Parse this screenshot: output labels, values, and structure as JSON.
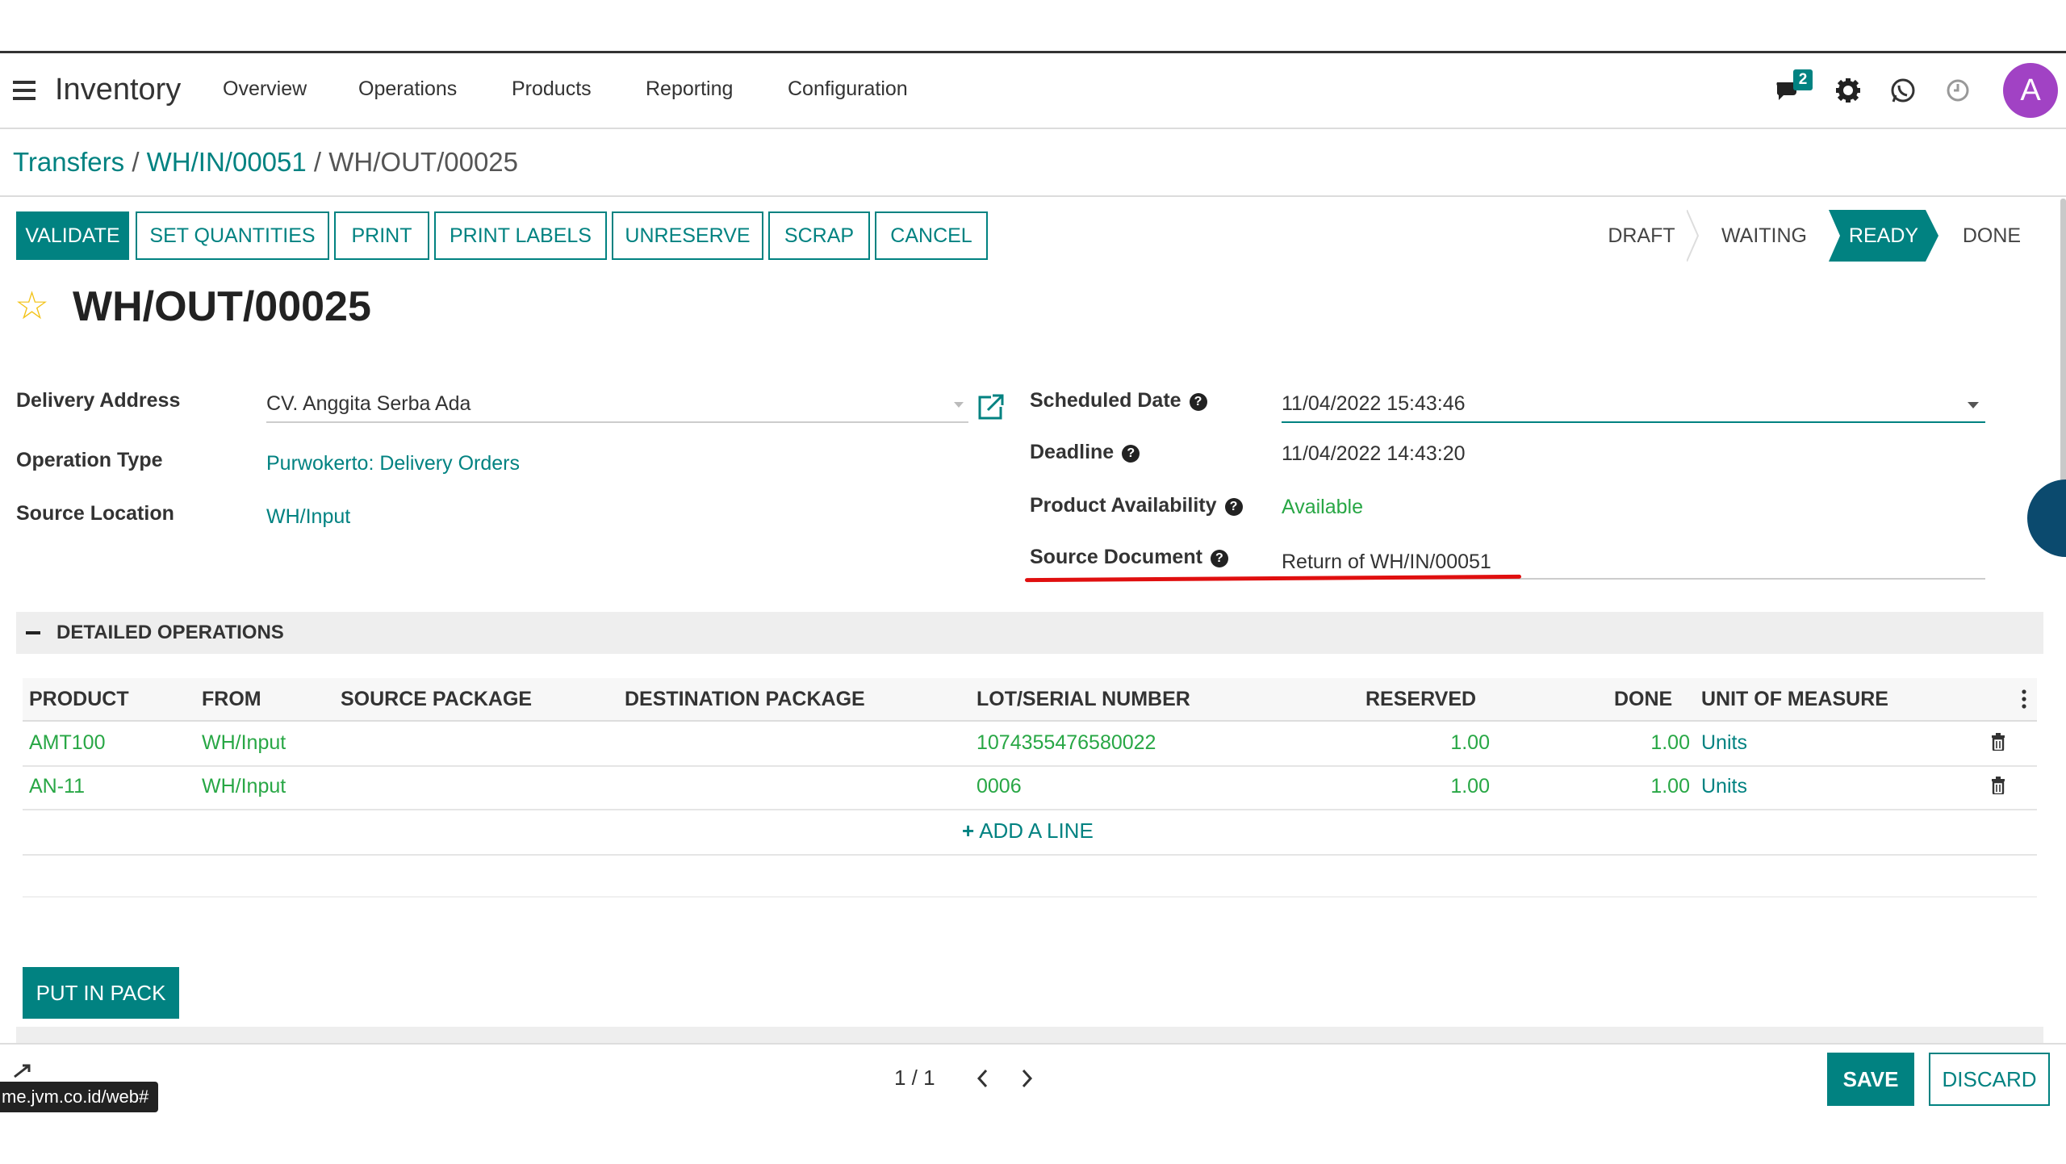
{
  "navbar": {
    "app_title": "Inventory",
    "menu": [
      "Overview",
      "Operations",
      "Products",
      "Reporting",
      "Configuration"
    ],
    "message_count": "2",
    "avatar_letter": "A",
    "icons": [
      "menu-icon",
      "chat-icon",
      "gear-icon",
      "whatsapp-icon",
      "clock-icon"
    ]
  },
  "breadcrumb": {
    "items": [
      "Transfers",
      "WH/IN/00051"
    ],
    "separator": "/",
    "current": "WH/OUT/00025"
  },
  "control_buttons": [
    "VALIDATE",
    "SET QUANTITIES",
    "PRINT",
    "PRINT LABELS",
    "UNRESERVE",
    "SCRAP",
    "CANCEL"
  ],
  "status_bar": {
    "states": [
      "DRAFT",
      "WAITING",
      "READY",
      "DONE"
    ],
    "active": "READY"
  },
  "record": {
    "title": "WH/OUT/00025"
  },
  "form": {
    "delivery_address": {
      "label": "Delivery Address",
      "value": "CV. Anggita Serba Ada"
    },
    "operation_type": {
      "label": "Operation Type",
      "value": "Purwokerto: Delivery Orders"
    },
    "source_location": {
      "label": "Source Location",
      "value": "WH/Input"
    },
    "scheduled_date": {
      "label": "Scheduled Date",
      "value": "11/04/2022 15:43:46"
    },
    "deadline": {
      "label": "Deadline",
      "value": "11/04/2022 14:43:20"
    },
    "product_availability": {
      "label": "Product Availability",
      "value": "Available"
    },
    "source_document": {
      "label": "Source Document",
      "value": "Return of WH/IN/00051"
    }
  },
  "help_glyph": "?",
  "detailed_operations": {
    "title": "DETAILED OPERATIONS",
    "columns": [
      "PRODUCT",
      "FROM",
      "SOURCE PACKAGE",
      "DESTINATION PACKAGE",
      "LOT/SERIAL NUMBER",
      "RESERVED",
      "DONE",
      "UNIT OF MEASURE"
    ],
    "rows": [
      {
        "product": "AMT100",
        "from": "WH/Input",
        "lot": "1074355476580022",
        "reserved": "1.00",
        "done": "1.00",
        "uom": "Units"
      },
      {
        "product": "AN-11",
        "from": "WH/Input",
        "lot": "0006",
        "reserved": "1.00",
        "done": "1.00",
        "uom": "Units"
      }
    ],
    "add_line": "ADD A LINE"
  },
  "put_in_pack": "PUT IN PACK",
  "footer": {
    "pager": "1 / 1",
    "save": "SAVE",
    "discard": "DISCARD",
    "url_tooltip": "me.jvm.co.id/web#"
  },
  "colors": {
    "accent": "#018281",
    "available": "#28a745",
    "avatar": "#a142c4",
    "star": "#f3c318",
    "annotation": "#e00f0f"
  }
}
